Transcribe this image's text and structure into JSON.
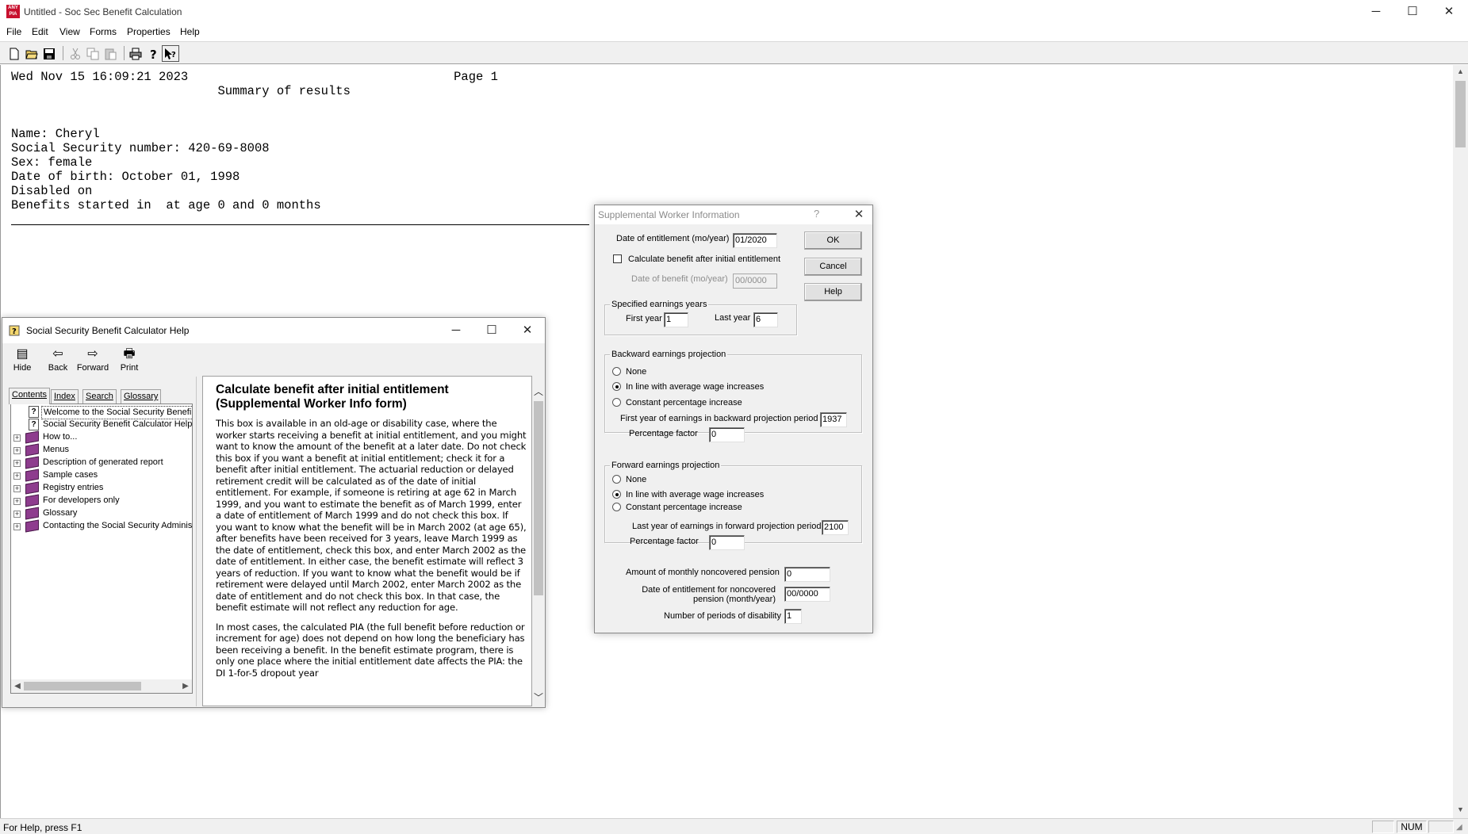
{
  "window": {
    "title": "Untitled - Soc Sec Benefit Calculation",
    "app_icon_text": "ANY PIA",
    "controls": {
      "minimize": "─",
      "maximize": "☐",
      "close": "✕"
    }
  },
  "menu": {
    "items": [
      "File",
      "Edit",
      "View",
      "Forms",
      "Properties",
      "Help"
    ]
  },
  "toolbar": {
    "buttons": [
      "new-icon",
      "open-icon",
      "save-icon",
      "cut-icon",
      "copy-icon",
      "paste-icon",
      "print-icon",
      "help-icon",
      "context-help-icon"
    ]
  },
  "report": {
    "lines": [
      "Wed Nov 15 16:09:21 2023                                    Page 1",
      "                            Summary of results",
      "",
      "",
      "Name: Cheryl",
      "Social Security number: 420-69-8008",
      "Sex: female",
      "Date of birth: October 01, 1998",
      "Disabled on",
      "Benefits started in  at age 0 and 0 months"
    ]
  },
  "status_bar": {
    "message": "For Help, press F1",
    "num": "NUM"
  },
  "help_window": {
    "title": "Social Security Benefit Calculator Help",
    "controls": {
      "minimize": "─",
      "maximize": "☐",
      "close": "✕"
    },
    "toolbar": [
      {
        "label": "Hide",
        "icon": "hide-icon"
      },
      {
        "label": "Back",
        "icon": "back-arrow-icon"
      },
      {
        "label": "Forward",
        "icon": "forward-arrow-icon"
      },
      {
        "label": "Print",
        "icon": "print-icon"
      }
    ],
    "tabs": [
      "Contents",
      "Index",
      "Search",
      "Glossary"
    ],
    "active_tab": "Contents",
    "tree": [
      {
        "label": "Welcome to the Social Security Benefi",
        "type": "page",
        "expandable": false
      },
      {
        "label": "Social Security Benefit Calculator Help",
        "type": "page",
        "expandable": false
      },
      {
        "label": "How to...",
        "type": "book",
        "expandable": true
      },
      {
        "label": "Menus",
        "type": "book",
        "expandable": true
      },
      {
        "label": "Description of generated report",
        "type": "book",
        "expandable": true
      },
      {
        "label": "Sample cases",
        "type": "book",
        "expandable": true
      },
      {
        "label": "Registry entries",
        "type": "book",
        "expandable": true
      },
      {
        "label": "For developers only",
        "type": "book",
        "expandable": true
      },
      {
        "label": "Glossary",
        "type": "book",
        "expandable": true
      },
      {
        "label": "Contacting the Social Security Adminis",
        "type": "book",
        "expandable": true
      }
    ],
    "content": {
      "heading": "Calculate benefit after initial entitlement (Supplemental Worker Info form)",
      "paragraph1": "This box is available in an old-age or disability case, where the worker starts receiving a benefit at initial entitlement, and you might want to know the amount of the benefit at a later date. Do not check this box if you want a benefit at initial entitlement; check it for a benefit after initial entitlement. The actuarial reduction or delayed retirement credit will be calculated as of the date of initial entitlement. For example, if someone is retiring at age 62 in March 1999, and you want to estimate the benefit as of March 1999, enter a date of entitlement of March 1999 and do not check this box. If you want to know what the benefit will be in March 2002 (at age 65), after benefits have been received for 3 years, leave March 1999 as the date of entitlement, check this box, and enter March 2002 as the date of entitlement. In either case, the benefit estimate will reflect 3 years of reduction. If you want to know what the benefit would be if retirement were delayed until March 2002, enter March 2002 as the date of entitlement and do not check this box. In that case, the benefit estimate will not reflect any reduction for age.",
      "paragraph2": "In most cases, the calculated PIA (the full benefit before reduction or increment for age) does not depend on how long the beneficiary has been receiving a benefit. In the benefit estimate program, there is only one place where the initial entitlement date affects the PIA: the DI 1-for-5 dropout year"
    }
  },
  "dialog": {
    "title": "Supplemental Worker Information",
    "help_glyph": "?",
    "close_glyph": "✕",
    "buttons": {
      "ok": "OK",
      "cancel": "Cancel",
      "help": "Help"
    },
    "entitlement": {
      "label": "Date of entitlement (mo/year)",
      "value": "01/2020"
    },
    "calc_after": {
      "label": "Calculate benefit after initial entitlement",
      "checked": false
    },
    "benefit_date": {
      "label": "Date of benefit (mo/year)",
      "value": "00/0000",
      "disabled": true
    },
    "specified_years": {
      "legend": "Specified earnings years",
      "first_label": "First year",
      "first_value": "1",
      "last_label": "Last year",
      "last_value": "6"
    },
    "backward": {
      "legend": "Backward earnings projection",
      "options": [
        "None",
        "In line with average wage increases",
        "Constant percentage increase"
      ],
      "selected": 1,
      "first_year_label": "First year of earnings in backward projection period",
      "first_year_value": "1937",
      "pct_label": "Percentage factor",
      "pct_value": "0"
    },
    "forward": {
      "legend": "Forward earnings projection",
      "options": [
        "None",
        "In line with average wage increases",
        "Constant percentage increase"
      ],
      "selected": 1,
      "last_year_label": "Last year of earnings in forward projection period",
      "last_year_value": "2100",
      "pct_label": "Percentage factor",
      "pct_value": "0"
    },
    "pension_amount": {
      "label": "Amount of monthly noncovered pension",
      "value": "0"
    },
    "pension_date": {
      "label_line1": "Date of entitlement for noncovered",
      "label_line2": "pension (month/year)",
      "value": "00/0000"
    },
    "disability_periods": {
      "label": "Number of periods of disability",
      "value": "1"
    }
  }
}
